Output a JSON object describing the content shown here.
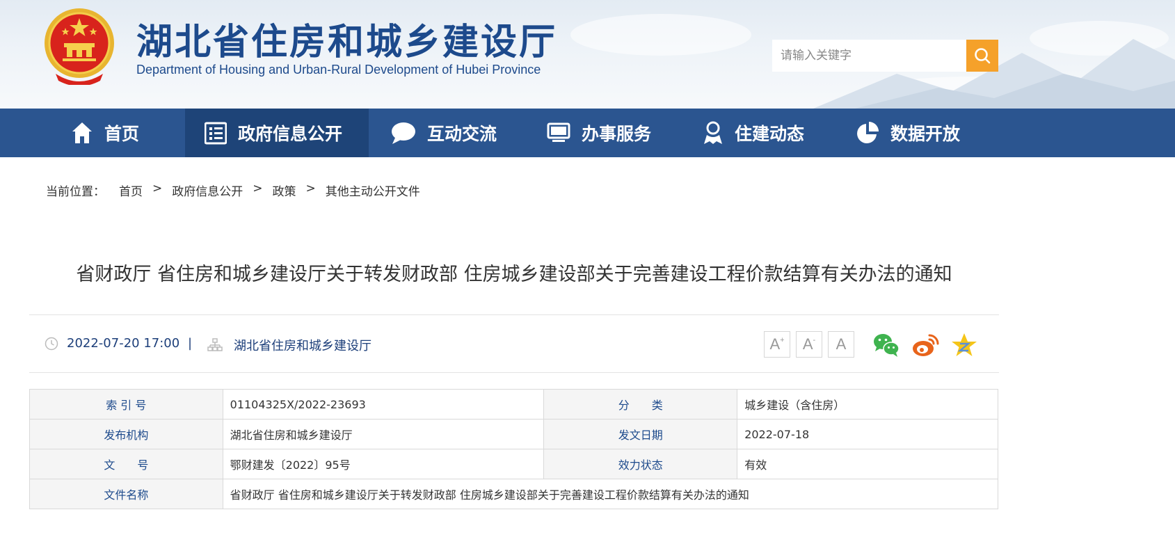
{
  "header": {
    "title_cn": "湖北省住房和城乡建设厅",
    "title_en": "Department of Housing and Urban-Rural Development of Hubei Province",
    "search_placeholder": "请输入关键字",
    "emblem_icon": "national-emblem-icon"
  },
  "nav": {
    "items": [
      {
        "label": "首页",
        "icon": "home-icon"
      },
      {
        "label": "政府信息公开",
        "icon": "document-list-icon",
        "active": true
      },
      {
        "label": "互动交流",
        "icon": "chat-bubble-icon"
      },
      {
        "label": "办事服务",
        "icon": "monitor-icon"
      },
      {
        "label": "住建动态",
        "icon": "person-badge-icon"
      },
      {
        "label": "数据开放",
        "icon": "pie-chart-icon"
      }
    ]
  },
  "breadcrumb": {
    "label": "当前位置：",
    "items": [
      "首页",
      "政府信息公开",
      "政策",
      "其他主动公开文件"
    ],
    "separator": ">"
  },
  "article": {
    "title": "省财政厅 省住房和城乡建设厅关于转发财政部 住房城乡建设部关于完善建设工程价款结算有关办法的通知",
    "datetime": "2022-07-20 17:00",
    "meta_separator": "|",
    "source": "湖北省住房和城乡建设厅"
  },
  "font_controls": {
    "increase": "A",
    "increase_mark": "+",
    "decrease": "A",
    "decrease_mark": "-",
    "reset": "A"
  },
  "share": {
    "icons": [
      "wechat-icon",
      "weibo-icon",
      "favorite-star-icon"
    ]
  },
  "info": {
    "rows": [
      {
        "l1": "索 引 号",
        "v1": "01104325X/2022-23693",
        "l2": "分　　类",
        "v2": "城乡建设（含住房）"
      },
      {
        "l1": "发布机构",
        "v1": "湖北省住房和城乡建设厅",
        "l2": "发文日期",
        "v2": "2022-07-18"
      },
      {
        "l1": "文　　号",
        "v1": "鄂财建发〔2022〕95号",
        "l2": "效力状态",
        "v2": "有效"
      }
    ],
    "doc_name_label": "文件名称",
    "doc_name_value": "省财政厅 省住房和城乡建设厅关于转发财政部 住房城乡建设部关于完善建设工程价款结算有关办法的通知"
  },
  "colors": {
    "brand_blue": "#2b5590",
    "nav_active": "#1e4478",
    "search_accent": "#f5a12a",
    "wechat_green": "#3fb34f",
    "weibo_orange": "#e8641b",
    "star_yellow": "#f5c518"
  }
}
